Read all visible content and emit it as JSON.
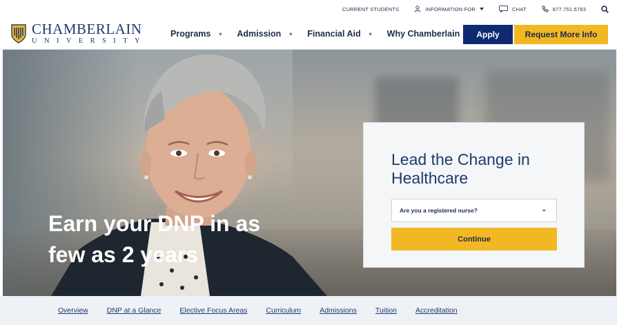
{
  "utility_bar": {
    "current_students": "CURRENT STUDENTS",
    "information_for": "INFORMATION FOR",
    "chat": "CHAT",
    "phone": "877.751.5783"
  },
  "logo": {
    "name": "CHAMBERLAIN",
    "sub": "UNIVERSITY"
  },
  "nav": {
    "items": [
      {
        "label": "Programs"
      },
      {
        "label": "Admission"
      },
      {
        "label": "Financial Aid"
      },
      {
        "label": "Why Chamberlain"
      }
    ],
    "apply_label": "Apply",
    "request_label": "Request More Info"
  },
  "hero": {
    "heading": "Earn your DNP in as few as 2 years"
  },
  "form": {
    "title": "Lead the Change in Healthcare",
    "select_value": "Are you a registered nurse?",
    "continue_label": "Continue"
  },
  "subnav": {
    "items": [
      {
        "label": "Overview"
      },
      {
        "label": "DNP at a Glance"
      },
      {
        "label": "Elective Focus Areas"
      },
      {
        "label": "Curriculum"
      },
      {
        "label": "Admissions"
      },
      {
        "label": "Tuition"
      },
      {
        "label": "Accreditation"
      }
    ]
  },
  "colors": {
    "navy": "#0e2b72",
    "brand_blue": "#1f3a6e",
    "gold": "#f2b824",
    "subnav_bg": "#eef2f6"
  }
}
